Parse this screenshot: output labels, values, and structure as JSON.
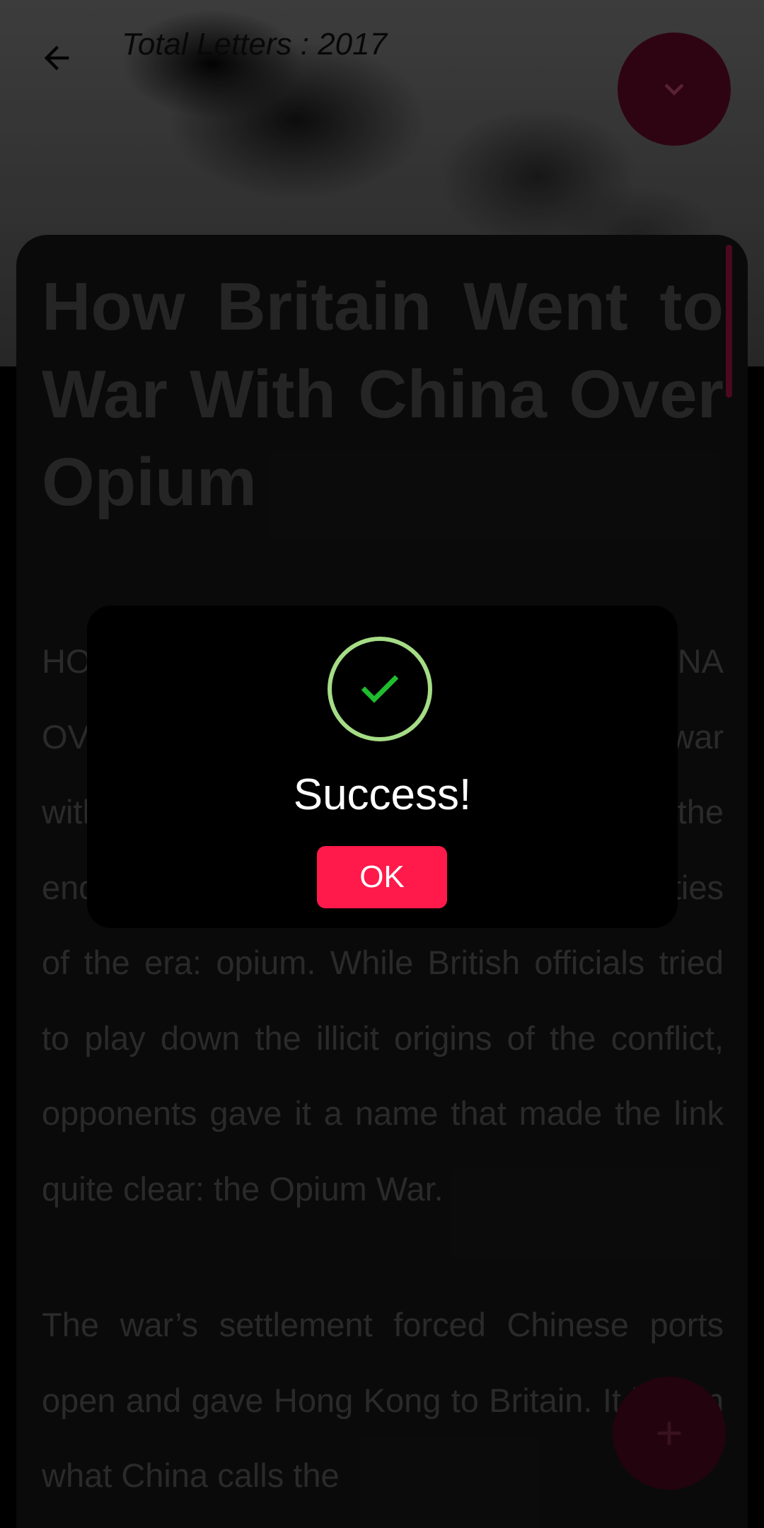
{
  "header": {
    "letters_label": "Total Letters : 2017",
    "back_icon": "arrow-left-icon",
    "collapse_icon": "chevron-down-icon"
  },
  "article": {
    "title": "How Britain Went to War With China Over Opium",
    "paragraphs": [
      "HOW BRITAIN WENT TO WAR WITH CHINA OVER OPIUM. In 1839, Britain went to war with China over trade, diplomacy and, in the end, one of the most important commodities of the era: opium. While British officials tried to play down the illicit origins of the conflict, opponents gave it a name that made the link quite clear: the Opium War.",
      "The war’s settlement forced Chinese ports open and gave Hong Kong to Britain. It began what China calls the"
    ]
  },
  "fab": {
    "add_icon": "plus-icon"
  },
  "dialog": {
    "icon": "check-icon",
    "title": "Success!",
    "ok_label": "OK"
  },
  "colors": {
    "accent": "#ff1a4b",
    "success_ring": "#a5dc86",
    "success_check": "#1fbd2e",
    "fab_dim": "#3a0617"
  }
}
